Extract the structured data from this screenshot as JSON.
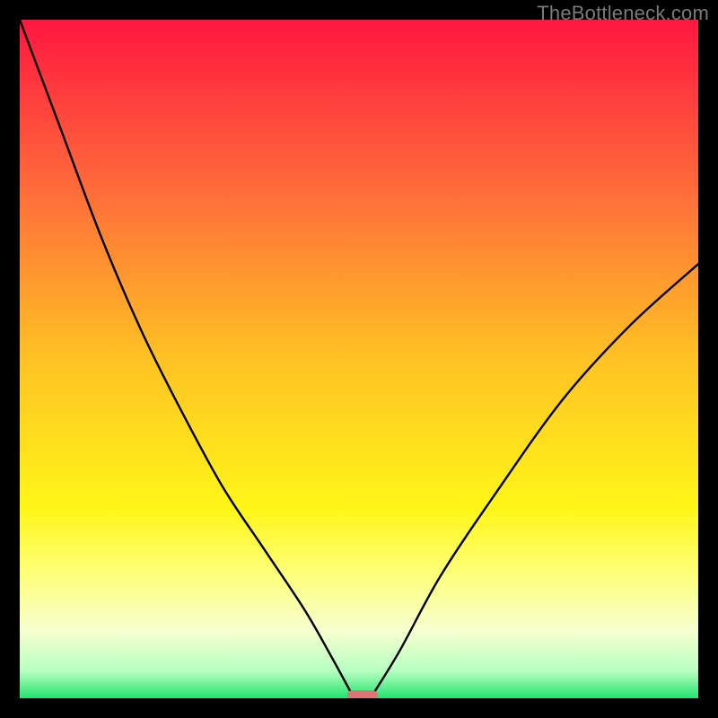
{
  "watermark": "TheBottleneck.com",
  "chart_data": {
    "type": "line",
    "title": "",
    "xlabel": "",
    "ylabel": "",
    "xlim": [
      0,
      100
    ],
    "ylim": [
      0,
      100
    ],
    "grid": false,
    "legend": false,
    "series": [
      {
        "name": "left-arm",
        "x": [
          0,
          6,
          12,
          18,
          24,
          30,
          36,
          42,
          46,
          49
        ],
        "values": [
          100,
          84,
          68,
          54,
          42,
          31,
          22,
          13,
          6,
          0.5
        ]
      },
      {
        "name": "right-arm",
        "x": [
          52,
          56,
          62,
          70,
          80,
          90,
          100
        ],
        "values": [
          0.5,
          7,
          18,
          30,
          44,
          55,
          64
        ]
      }
    ],
    "marker": {
      "name": "minimum-band",
      "x_center": 50.5,
      "width": 4.5,
      "y": 0.5,
      "color": "#de7574"
    },
    "background_gradient": {
      "stops": [
        {
          "offset": 0.0,
          "color": "#ff1740"
        },
        {
          "offset": 0.25,
          "color": "#ff6c3a"
        },
        {
          "offset": 0.5,
          "color": "#ffc224"
        },
        {
          "offset": 0.72,
          "color": "#fff618"
        },
        {
          "offset": 0.82,
          "color": "#fdff7d"
        },
        {
          "offset": 0.9,
          "color": "#f6ffd0"
        },
        {
          "offset": 0.96,
          "color": "#b7ffc0"
        },
        {
          "offset": 1.0,
          "color": "#22e36d"
        }
      ]
    }
  }
}
